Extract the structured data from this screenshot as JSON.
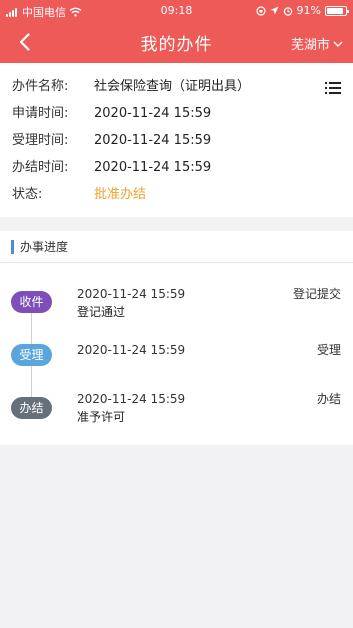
{
  "status_bar": {
    "carrier": "中国电信",
    "time": "09:18",
    "battery": "91%",
    "battery_level": 0.91
  },
  "nav": {
    "title": "我的办件",
    "city": "芜湖市",
    "back_icon": "chevron-left-icon",
    "city_icon": "chevron-down-icon"
  },
  "info": {
    "rows": [
      {
        "label": "办件名称:",
        "value": "社会保险查询（证明出具）"
      },
      {
        "label": "申请时间:",
        "value": "2020-11-24 15:59"
      },
      {
        "label": "受理时间:",
        "value": "2020-11-24 15:59"
      },
      {
        "label": "办结时间:",
        "value": "2020-11-24 15:59"
      },
      {
        "label": "状态:",
        "value": "批准办结"
      }
    ],
    "status_color": "#f0a030"
  },
  "progress": {
    "title": "办事进度",
    "steps": [
      {
        "badge": "收件",
        "time": "2020-11-24 15:59",
        "action": "登记提交",
        "remark": "登记通过",
        "color": "#7e4fb8"
      },
      {
        "badge": "受理",
        "time": "2020-11-24 15:59",
        "action": "受理",
        "remark": "",
        "color": "#5aa6dc"
      },
      {
        "badge": "办结",
        "time": "2020-11-24 15:59",
        "action": "办结",
        "remark": "准予许可",
        "color": "#66707a"
      }
    ]
  },
  "colors": {
    "header": "#ee5a58",
    "accent_bar": "#4a8fd6",
    "background": "#f2f2f4"
  }
}
